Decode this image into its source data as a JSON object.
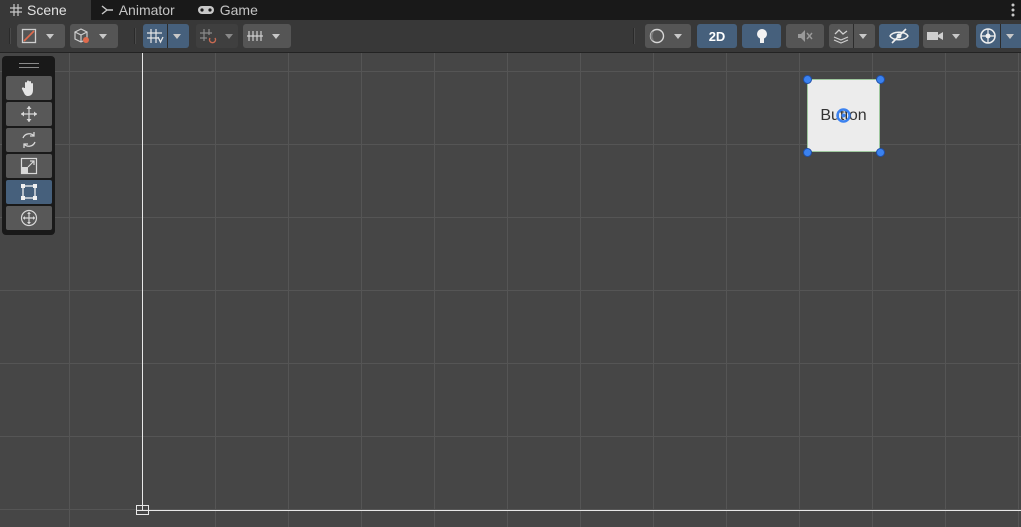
{
  "tabs": [
    {
      "label": "Scene",
      "icon": "grid-icon",
      "active": true
    },
    {
      "label": "Animator",
      "icon": "animator-icon",
      "active": false
    },
    {
      "label": "Game",
      "icon": "gamepad-icon",
      "active": false
    }
  ],
  "toolbar": {
    "mode_2d_label": "2D",
    "left_tools": [
      "draw-mode-icon",
      "gizmo-cube-icon",
      "grid-snap-icon",
      "increment-snap-icon",
      "ruler-icon"
    ],
    "right_tools": [
      "shading-sphere-icon",
      "lighting-bulb-icon",
      "audio-mute-icon",
      "effects-icon",
      "hidden-eye-icon",
      "camera-icon",
      "gizmos-icon"
    ],
    "accent_color": "#46607c"
  },
  "tool_palette": [
    "hand-tool-icon",
    "move-tool-icon",
    "rotate-tool-icon",
    "scale-tool-icon",
    "rect-tool-icon",
    "transform-tool-icon"
  ],
  "active_tool": "rect-tool-icon",
  "scene_button": {
    "label": "Button"
  },
  "colors": {
    "scene_bg": "#464646",
    "grid": "#555555",
    "handle": "#3b82f0"
  }
}
